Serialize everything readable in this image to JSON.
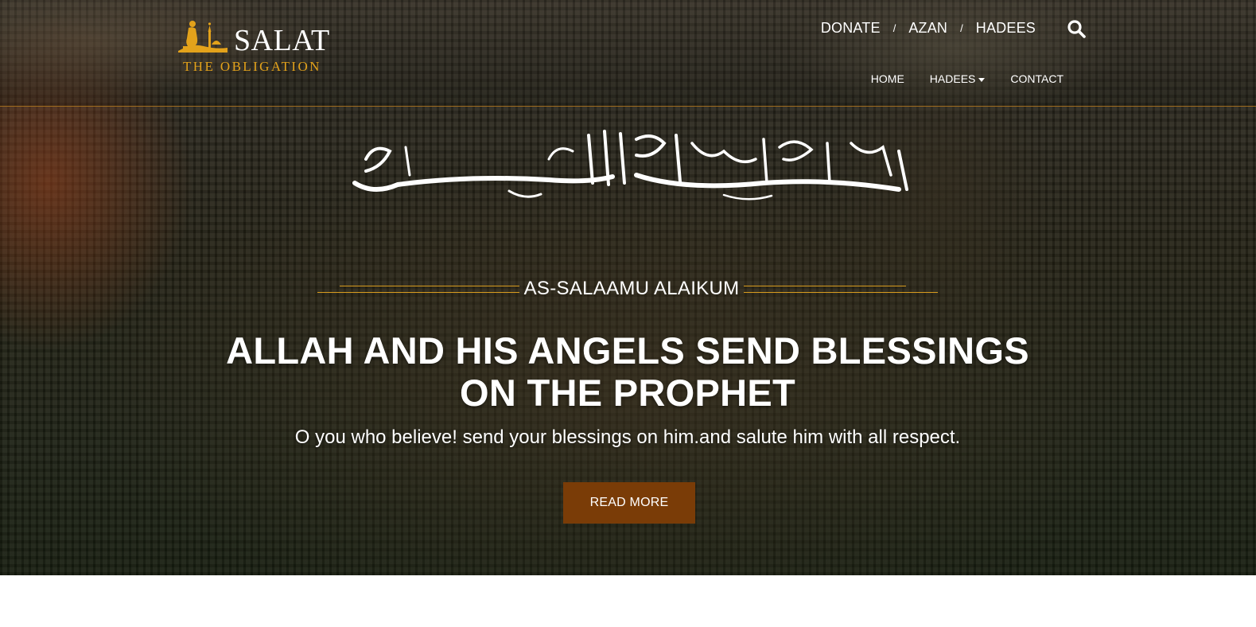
{
  "brand": {
    "name": "SALAT",
    "tagline": "THE OBLIGATION"
  },
  "top_nav": {
    "items": [
      "DONATE",
      "AZAN",
      "HADEES"
    ],
    "separator": "/"
  },
  "main_nav": {
    "home": "HOME",
    "hadees": "HADEES",
    "contact": "CONTACT"
  },
  "hero": {
    "greeting": "AS-SALAAMU ALAIKUM",
    "headline_line1": "ALLAH AND HIS ANGELS SEND BLESSINGS",
    "headline_line2": "ON THE PROPHET",
    "subline": "O you who believe! send your blessings on him.and salute him with all respect.",
    "button_label": "READ MORE"
  },
  "colors": {
    "accent": "#d79b1e",
    "button": "#7a3c07",
    "brand_tagline": "#e3a21b"
  },
  "icons": {
    "search": "search-icon",
    "logo": "praying-figure-mosque-icon",
    "calligraphy": "bismillah-calligraphy",
    "dropdown": "caret-down-icon"
  }
}
